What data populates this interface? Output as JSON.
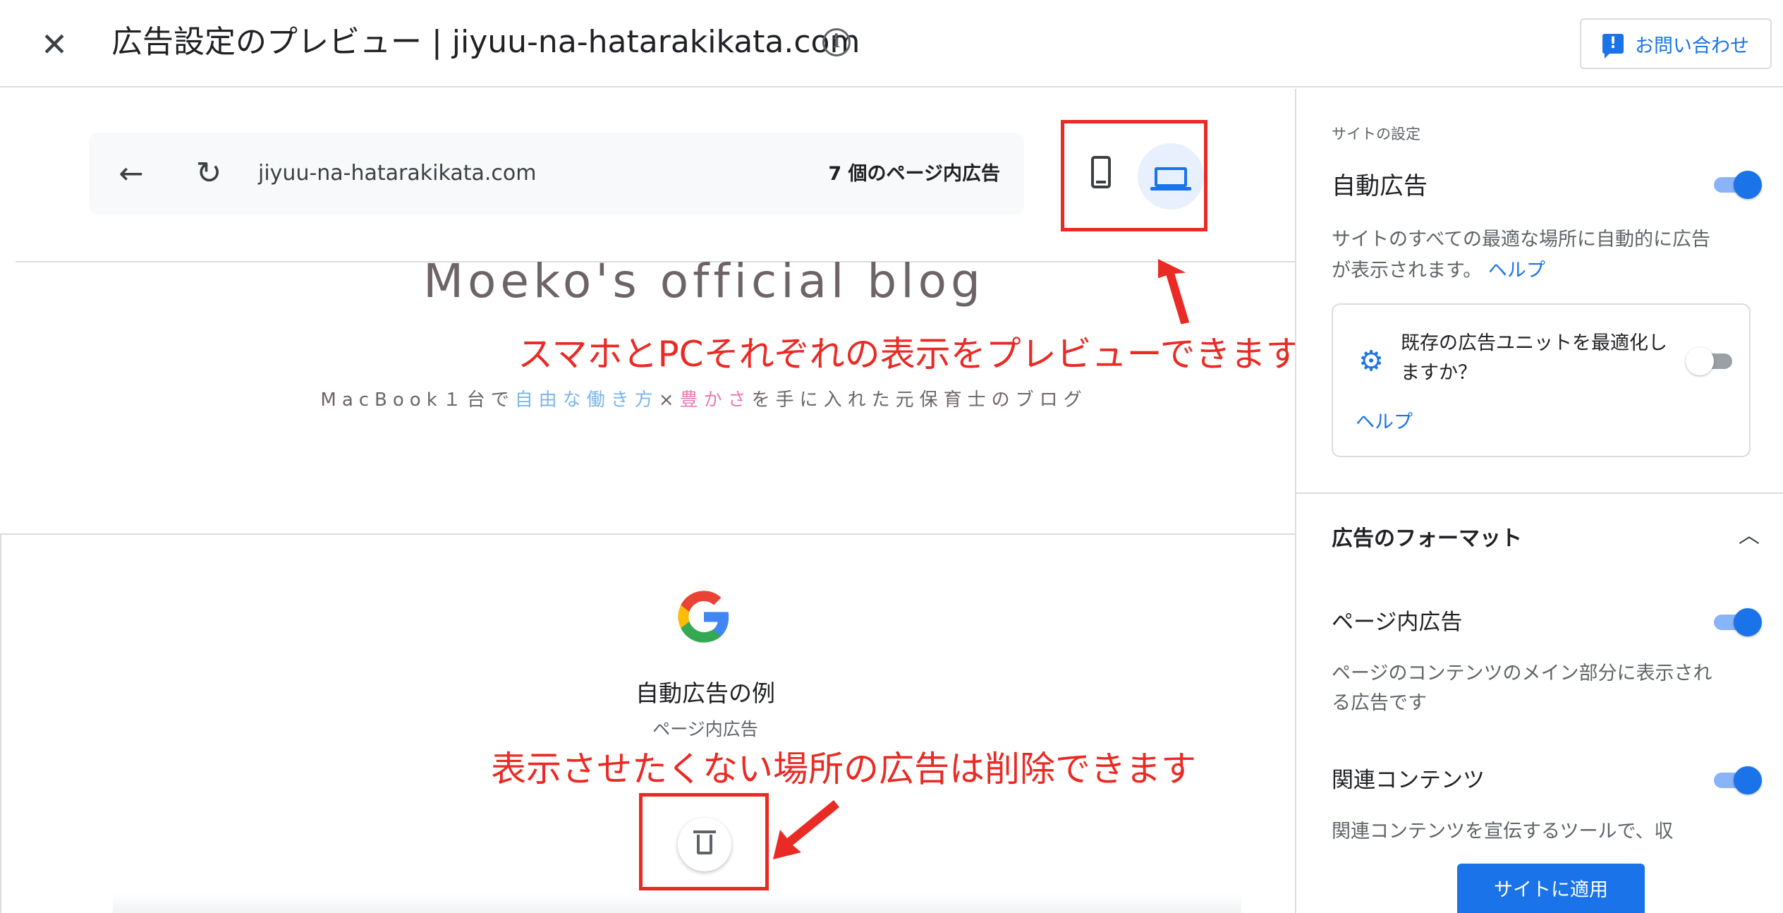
{
  "header": {
    "title": "広告設定のプレビュー | jiyuu-na-hatarakikata.com",
    "contact_label": "お問い合わせ"
  },
  "browser": {
    "url": "jiyuu-na-hatarakikata.com",
    "ad_count": "7 個のページ内広告"
  },
  "blog": {
    "title": "Moeko's official blog",
    "subtitle_part1": "MacBook１台で",
    "subtitle_blue": "自由な働き方",
    "subtitle_x": "×",
    "subtitle_pink": "豊かさ",
    "subtitle_part2": "を手に入れた元保育士のブログ"
  },
  "annotations": {
    "device_preview": "スマホとPCそれぞれの表示をプレビューできます",
    "delete_ads": "表示させたくない場所の広告は削除できます"
  },
  "ad_example": {
    "title": "自動広告の例",
    "subtitle": "ページ内広告"
  },
  "panel": {
    "site_settings_label": "サイトの設定",
    "auto_ads": {
      "label": "自動広告",
      "enabled": true,
      "description": "サイトのすべての最適な場所に自動的に広告が表示されます。",
      "help": "ヘルプ"
    },
    "optimize": {
      "text": "既存の広告ユニットを最適化しますか？",
      "enabled": false,
      "help": "ヘルプ"
    },
    "ad_formats_label": "広告のフォーマット",
    "inpage": {
      "label": "ページ内広告",
      "enabled": true,
      "description": "ページのコンテンツのメイン部分に表示される広告です"
    },
    "related": {
      "label": "関連コンテンツ",
      "enabled": true,
      "description": "関連コンテンツを宣伝するツールで、収"
    },
    "apply_label": "サイトに適用"
  },
  "colors": {
    "accent": "#1a73e8",
    "annotation": "#ea2a24"
  }
}
